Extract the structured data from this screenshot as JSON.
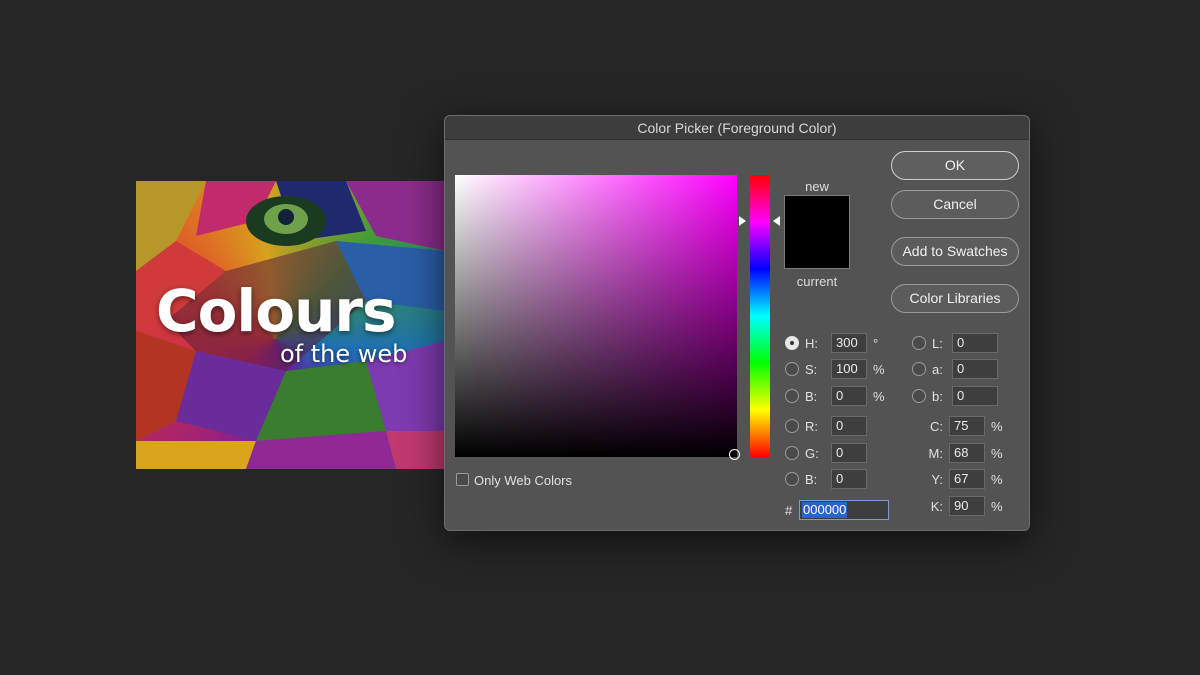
{
  "artwork": {
    "title": "Colours",
    "subtitle": "of the web"
  },
  "dialog": {
    "title": "Color Picker (Foreground Color)",
    "swatch_labels": {
      "new": "new",
      "current": "current"
    },
    "buttons": {
      "ok": "OK",
      "cancel": "Cancel",
      "add_swatches": "Add to Swatches",
      "libraries": "Color Libraries"
    },
    "hsb": {
      "h": {
        "label": "H:",
        "value": "300",
        "unit": "°"
      },
      "s": {
        "label": "S:",
        "value": "100",
        "unit": "%"
      },
      "b": {
        "label": "B:",
        "value": "0",
        "unit": "%"
      }
    },
    "rgb": {
      "r": {
        "label": "R:",
        "value": "0"
      },
      "g": {
        "label": "G:",
        "value": "0"
      },
      "b": {
        "label": "B:",
        "value": "0"
      }
    },
    "lab": {
      "l": {
        "label": "L:",
        "value": "0"
      },
      "a": {
        "label": "a:",
        "value": "0"
      },
      "b": {
        "label": "b:",
        "value": "0"
      }
    },
    "cmyk": {
      "c": {
        "label": "C:",
        "value": "75",
        "unit": "%"
      },
      "m": {
        "label": "M:",
        "value": "68",
        "unit": "%"
      },
      "y": {
        "label": "Y:",
        "value": "67",
        "unit": "%"
      },
      "k": {
        "label": "K:",
        "value": "90",
        "unit": "%"
      }
    },
    "only_web_colors": "Only Web Colors",
    "hex_prefix": "#",
    "hex_value": "000000",
    "colors": {
      "new": "#000000",
      "current": "#000000",
      "hue": "#ff00ff"
    }
  }
}
